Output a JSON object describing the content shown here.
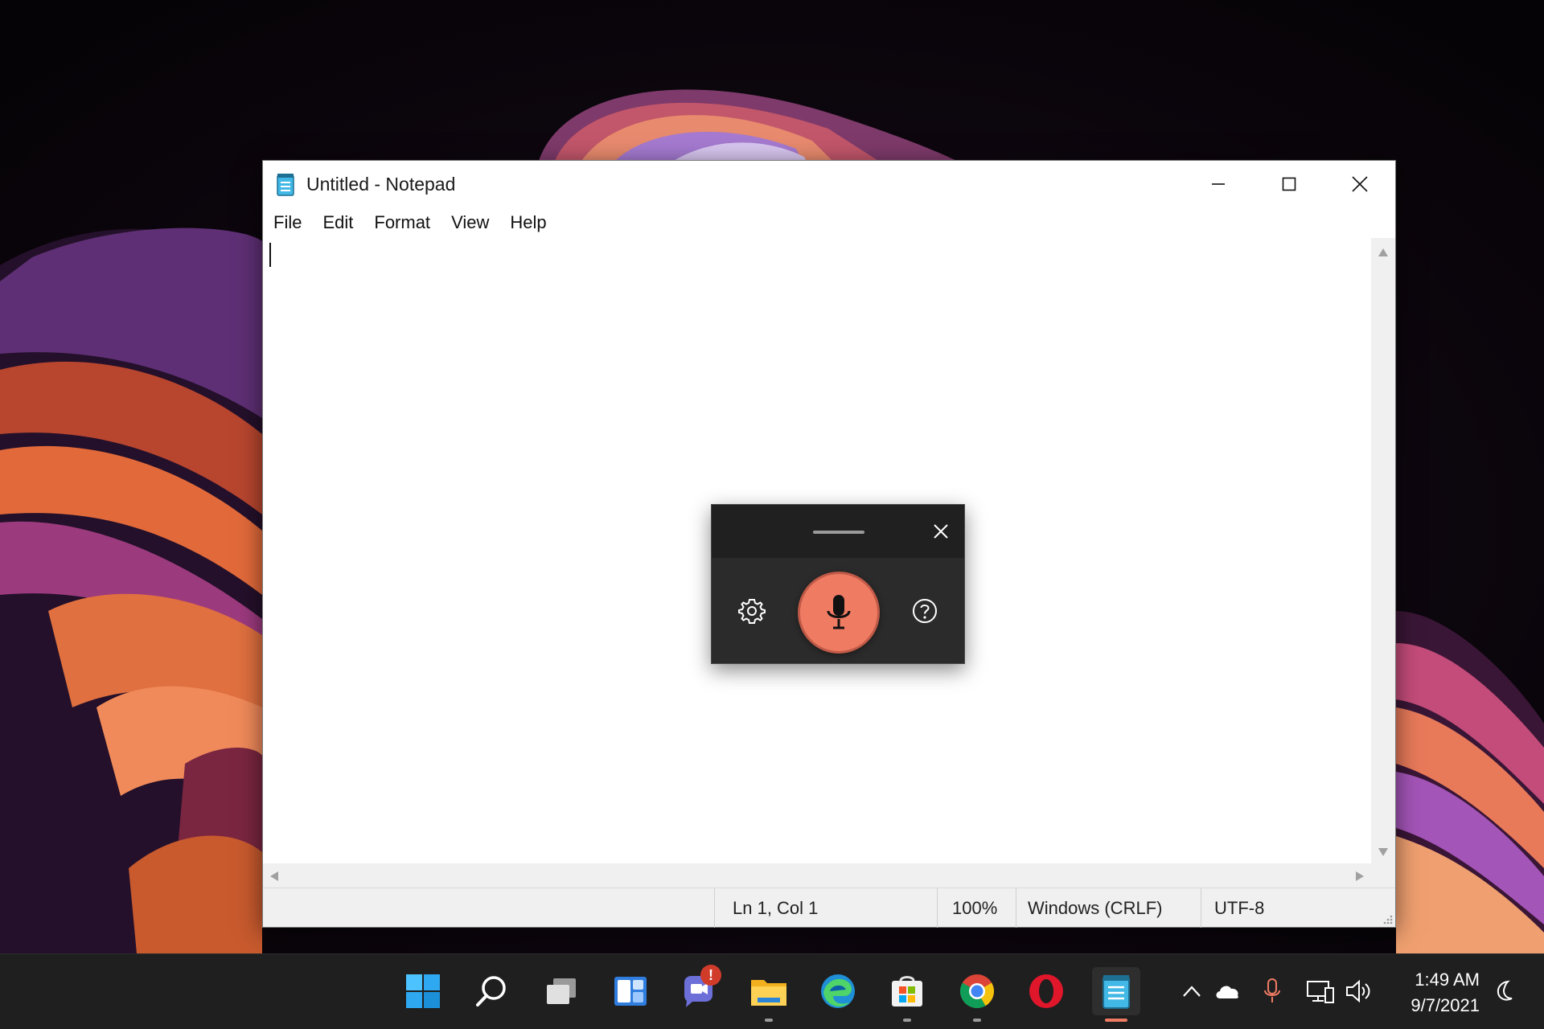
{
  "window": {
    "title": "Untitled - Notepad",
    "menu": [
      "File",
      "Edit",
      "Format",
      "View",
      "Help"
    ],
    "editor_text": ""
  },
  "statusbar": {
    "position": "Ln 1, Col 1",
    "zoom": "100%",
    "line_ending": "Windows (CRLF)",
    "encoding": "UTF-8"
  },
  "voice_typing": {
    "icons": [
      "drag-handle-icon",
      "close-icon",
      "gear-icon",
      "microphone-icon",
      "help-icon"
    ],
    "mic_color": "#ef7b63",
    "state": "listening"
  },
  "taskbar": {
    "pinned": [
      {
        "name": "start-icon",
        "active": false,
        "running": false
      },
      {
        "name": "search-icon",
        "active": false,
        "running": false
      },
      {
        "name": "task-view-icon",
        "active": false,
        "running": false
      },
      {
        "name": "widgets-icon",
        "active": false,
        "running": false
      },
      {
        "name": "teams-chat-icon",
        "active": false,
        "running": false,
        "badge": "!"
      },
      {
        "name": "file-explorer-icon",
        "active": false,
        "running": true
      },
      {
        "name": "edge-icon",
        "active": false,
        "running": false
      },
      {
        "name": "store-icon",
        "active": false,
        "running": true
      },
      {
        "name": "chrome-icon",
        "active": false,
        "running": true
      },
      {
        "name": "opera-icon",
        "active": false,
        "running": false
      },
      {
        "name": "notepad-icon",
        "active": true,
        "running": true
      }
    ],
    "tray": [
      "chevron-up-icon",
      "onedrive-cloud-icon",
      "microphone-icon",
      "network-icon",
      "volume-icon"
    ],
    "time": "1:49 AM",
    "date": "9/7/2021"
  },
  "colors": {
    "accent": "#0078d4",
    "mic": "#ef7b63",
    "taskbar": "#1f1f1f"
  }
}
